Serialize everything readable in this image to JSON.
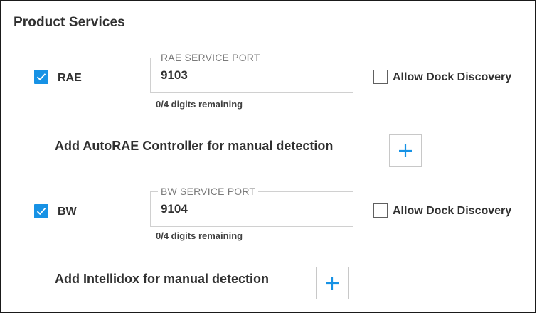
{
  "panel": {
    "title": "Product Services"
  },
  "services": [
    {
      "checked": true,
      "label": "RAE",
      "port_legend": "RAE SERVICE PORT",
      "port_value": "9103",
      "helper": "0/4 digits remaining",
      "dock_checked": false,
      "dock_label": "Allow Dock Discovery",
      "add_label": "Add AutoRAE Controller for manual detection"
    },
    {
      "checked": true,
      "label": "BW",
      "port_legend": "BW SERVICE PORT",
      "port_value": "9104",
      "helper": "0/4 digits remaining",
      "dock_checked": false,
      "dock_label": "Allow Dock Discovery",
      "add_label": "Add Intellidox for manual detection"
    }
  ],
  "colors": {
    "accent": "#1792e5",
    "text": "#303030",
    "border": "#d0d0d0"
  },
  "icons": {
    "check": "checkmark-icon",
    "add": "plus-icon"
  }
}
